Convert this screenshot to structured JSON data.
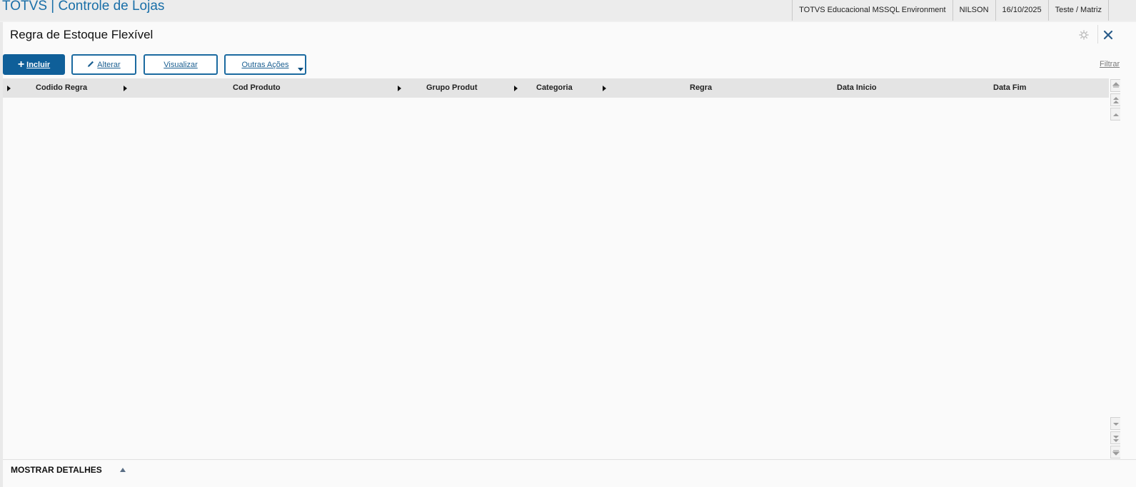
{
  "app": {
    "title": "TOTVS | Controle de Lojas"
  },
  "topbar": {
    "environment": "TOTVS Educacional MSSQL Environment",
    "user": "NILSON",
    "date": "16/10/2025",
    "branch": "Teste / Matriz"
  },
  "page": {
    "title": "Regra de Estoque Flexível",
    "icons": [
      "gear-icon",
      "close-icon"
    ]
  },
  "toolbar": {
    "include_label": "Incluir",
    "alter_label": "Alterar",
    "view_label": "Visualizar",
    "other_actions_label": "Outras Ações",
    "filter_label": "Filtrar"
  },
  "grid": {
    "columns": [
      {
        "label": "Codido Regra"
      },
      {
        "label": "Cod Produto"
      },
      {
        "label": "Grupo Produt"
      },
      {
        "label": "Categoria"
      },
      {
        "label": "Regra"
      },
      {
        "label": "Data Inicio"
      },
      {
        "label": "Data Fim"
      }
    ],
    "rows": []
  },
  "footer": {
    "details_label": "MOSTRAR DETALHES"
  },
  "colors": {
    "brand": "#1a6fa8",
    "primary_button": "#0f5f99",
    "header_bg": "#e4e4e4",
    "panel_bg": "#fafafa"
  }
}
